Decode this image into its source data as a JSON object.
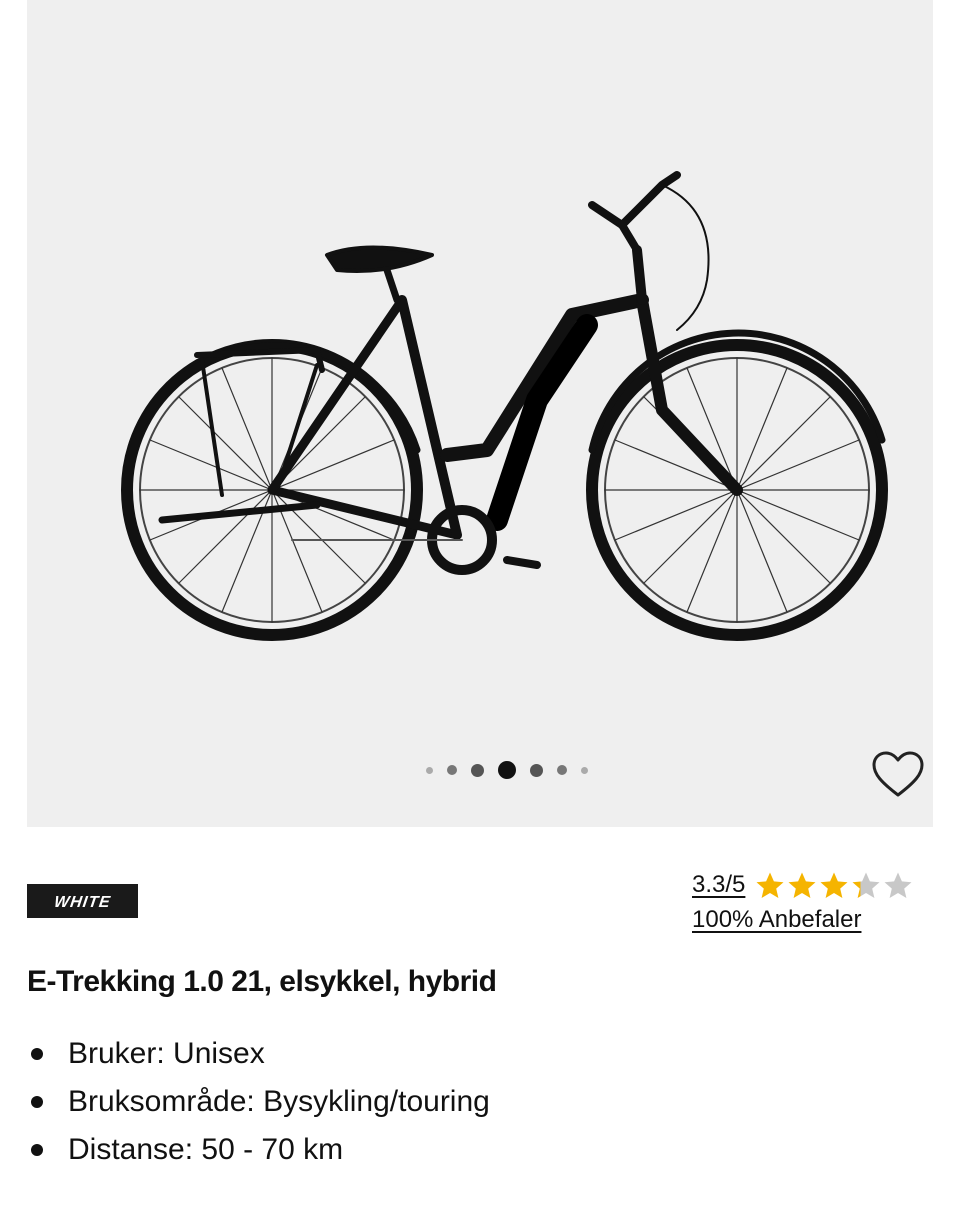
{
  "gallery": {
    "image_alt": "White E-Trekking 1.0 21 electric hybrid bicycle",
    "dots_count": 7,
    "active_index": 3
  },
  "brand": {
    "logo_text": "WHITE"
  },
  "rating": {
    "score_text": "3.3/5",
    "score": 3.3,
    "max": 5,
    "recommend_text": "100% Anbefaler",
    "star_color": "#f5b400",
    "star_empty_color": "#c8c8c8"
  },
  "product": {
    "title": "E-Trekking 1.0 21, elsykkel, hybrid",
    "features": [
      "Bruker: Unisex",
      "Bruksområde: Bysykling/touring",
      "Distanse: 50 - 70 km"
    ]
  },
  "icons": {
    "favorite": "heart-icon",
    "star": "star-icon"
  }
}
